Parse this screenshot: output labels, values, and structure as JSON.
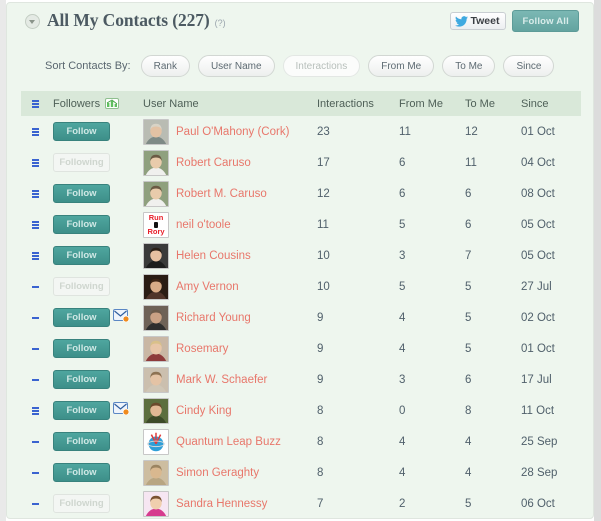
{
  "header": {
    "title": "All My Contacts (227)",
    "help_badge": "(?)",
    "tweet_label": "Tweet",
    "follow_all_label": "Follow All",
    "accent_teal": "#3d8f89",
    "accent_header_green": "#d9e8d9",
    "name_color": "#e8776b"
  },
  "sortbar": {
    "label": "Sort Contacts By:",
    "options": [
      {
        "label": "Rank",
        "active": false
      },
      {
        "label": "User Name",
        "active": false
      },
      {
        "label": "Interactions",
        "active": true
      },
      {
        "label": "From Me",
        "active": false
      },
      {
        "label": "To Me",
        "active": false
      },
      {
        "label": "Since",
        "active": false
      }
    ]
  },
  "table": {
    "columns": {
      "rank": "",
      "followers": "Followers",
      "user_name": "User Name",
      "interactions": "Interactions",
      "from_me": "From Me",
      "to_me": "To Me",
      "since": "Since"
    },
    "rows": [
      {
        "rank_bars": 3,
        "follow_state": "Follow",
        "has_mail": false,
        "avatar": "photo-man-light",
        "name": "Paul O'Mahony (Cork)",
        "interactions": "23",
        "from_me": "11",
        "to_me": "12",
        "since": "01 Oct"
      },
      {
        "rank_bars": 3,
        "follow_state": "Following",
        "has_mail": false,
        "avatar": "photo-man-outdoor",
        "name": "Robert Caruso",
        "interactions": "17",
        "from_me": "6",
        "to_me": "11",
        "since": "04 Oct"
      },
      {
        "rank_bars": 3,
        "follow_state": "Follow",
        "has_mail": false,
        "avatar": "photo-man-outdoor",
        "name": "Robert M. Caruso",
        "interactions": "12",
        "from_me": "6",
        "to_me": "6",
        "since": "08 Oct"
      },
      {
        "rank_bars": 3,
        "follow_state": "Follow",
        "has_mail": false,
        "avatar": "runrory-logo",
        "name": "neil o'toole",
        "interactions": "11",
        "from_me": "5",
        "to_me": "6",
        "since": "05 Oct"
      },
      {
        "rank_bars": 3,
        "follow_state": "Follow",
        "has_mail": false,
        "avatar": "photo-woman-dark",
        "name": "Helen Cousins",
        "interactions": "10",
        "from_me": "3",
        "to_me": "7",
        "since": "05 Oct"
      },
      {
        "rank_bars": 1,
        "follow_state": "Following",
        "has_mail": false,
        "avatar": "photo-woman-brown",
        "name": "Amy Vernon",
        "interactions": "10",
        "from_me": "5",
        "to_me": "5",
        "since": "27 Jul"
      },
      {
        "rank_bars": 1,
        "follow_state": "Follow",
        "has_mail": true,
        "avatar": "photo-man-bald",
        "name": "Richard Young",
        "interactions": "9",
        "from_me": "4",
        "to_me": "5",
        "since": "02 Oct"
      },
      {
        "rank_bars": 1,
        "follow_state": "Follow",
        "has_mail": false,
        "avatar": "photo-woman-blonde",
        "name": "Rosemary",
        "interactions": "9",
        "from_me": "4",
        "to_me": "5",
        "since": "01 Oct"
      },
      {
        "rank_bars": 1,
        "follow_state": "Follow",
        "has_mail": false,
        "avatar": "photo-glasses",
        "name": "Mark W. Schaefer",
        "interactions": "9",
        "from_me": "3",
        "to_me": "6",
        "since": "17 Jul"
      },
      {
        "rank_bars": 3,
        "follow_state": "Follow",
        "has_mail": true,
        "avatar": "photo-woman-green",
        "name": "Cindy King",
        "interactions": "8",
        "from_me": "0",
        "to_me": "8",
        "since": "11 Oct"
      },
      {
        "rank_bars": 1,
        "follow_state": "Follow",
        "has_mail": false,
        "avatar": "logo-quantum",
        "name": "Quantum Leap Buzz",
        "interactions": "8",
        "from_me": "4",
        "to_me": "4",
        "since": "25 Sep"
      },
      {
        "rank_bars": 1,
        "follow_state": "Follow",
        "has_mail": false,
        "avatar": "photo-man-sepia",
        "name": "Simon Geraghty",
        "interactions": "8",
        "from_me": "4",
        "to_me": "4",
        "since": "28 Sep"
      },
      {
        "rank_bars": 1,
        "follow_state": "Following",
        "has_mail": false,
        "avatar": "illustration-pink",
        "name": "Sandra Hennessy",
        "interactions": "7",
        "from_me": "2",
        "to_me": "5",
        "since": "06 Oct"
      }
    ]
  }
}
